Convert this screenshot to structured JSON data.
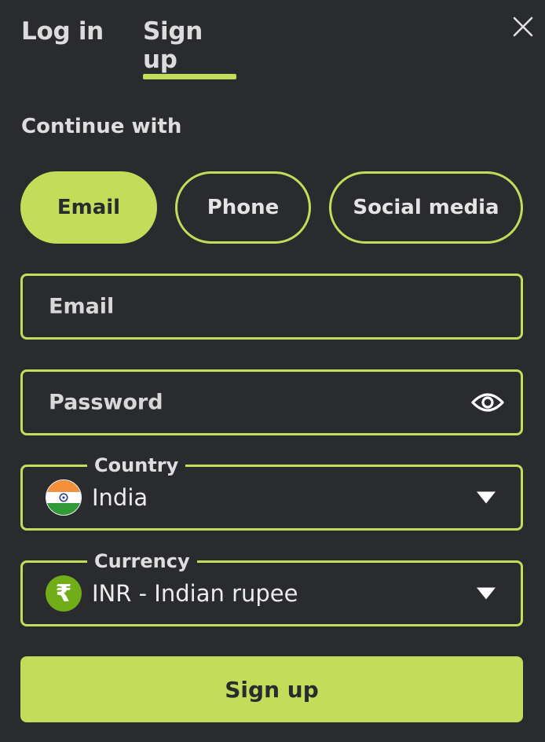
{
  "tabs": {
    "login_label": "Log in",
    "signup_label": "Sign up",
    "active": "signup"
  },
  "close_icon": "close-icon",
  "continue_label": "Continue with",
  "methods": [
    {
      "label": "Email",
      "active": true
    },
    {
      "label": "Phone",
      "active": false
    },
    {
      "label": "Social media",
      "active": false
    }
  ],
  "fields": {
    "email_placeholder": "Email",
    "password_placeholder": "Password",
    "password_icon": "eye-icon"
  },
  "country": {
    "label": "Country",
    "value": "India",
    "icon": "india-flag-icon"
  },
  "currency": {
    "label": "Currency",
    "value": "INR - Indian rupee",
    "symbol": "₹",
    "icon": "rupee-icon"
  },
  "submit_label": "Sign up",
  "colors": {
    "accent": "#c3dc5a",
    "background": "#2a2b2e",
    "rupee_badge": "#71ad19"
  }
}
